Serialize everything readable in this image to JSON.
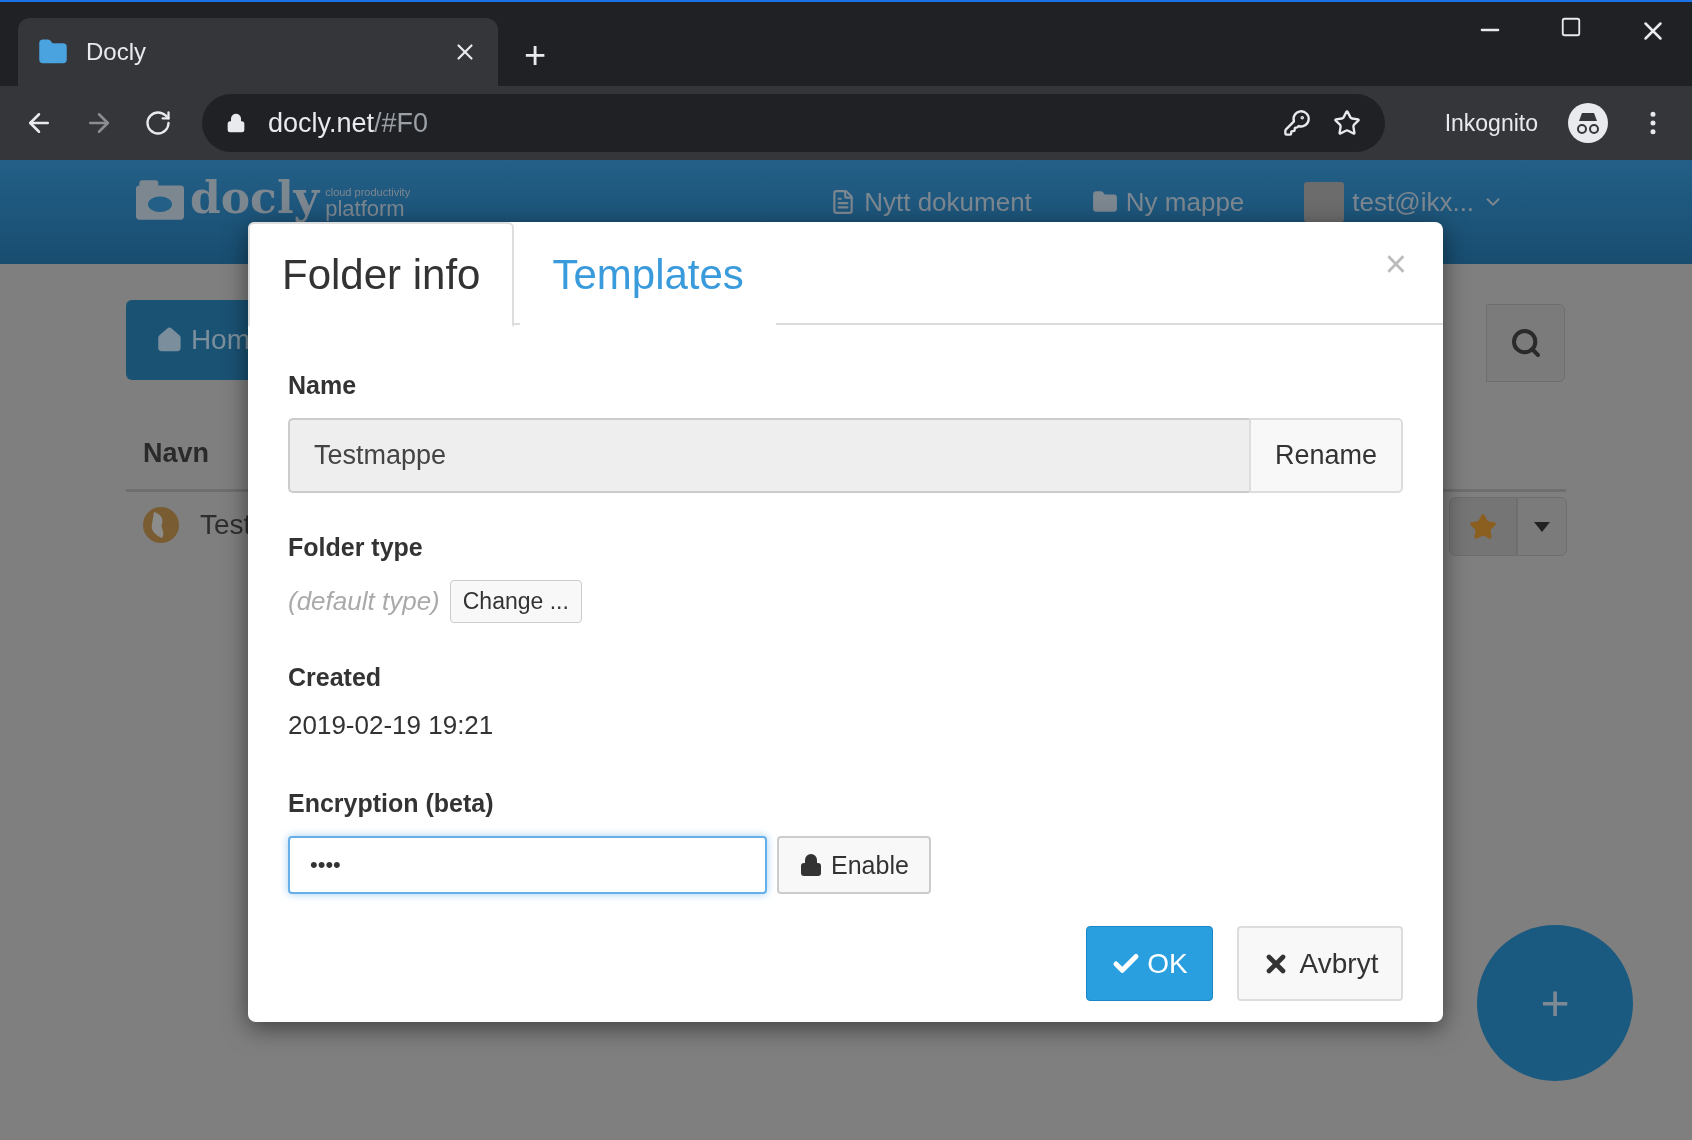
{
  "browser": {
    "tab_title": "Docly",
    "new_tab": "+",
    "url_host": "docly.net",
    "url_path": "/#F0",
    "profile": "Inkognito"
  },
  "header": {
    "logo": "docly",
    "tagline_1": "cloud productivity",
    "tagline_2": "platform",
    "nav": [
      "Nytt dokument",
      "Ny mappe"
    ],
    "user": "test@ikx..."
  },
  "page": {
    "home_button": "Hom",
    "column": "Navn",
    "row": "Test"
  },
  "dialog": {
    "tabs": [
      {
        "label": "Folder info",
        "selected": true
      },
      {
        "label": "Templates",
        "selected": false
      }
    ],
    "close": "×",
    "name_label": "Name",
    "name_value": "Testmappe",
    "rename": "Rename",
    "type_label": "Folder type",
    "type_value": "(default type)",
    "change": "Change ...",
    "created_label": "Created",
    "created_value": "2019-02-19 19:21",
    "encryption_label": "Encryption (beta)",
    "encryption_value": "••••",
    "encryption_focused": true,
    "enable": "Enable",
    "ok": "OK",
    "cancel": "Avbryt"
  },
  "fab": "+"
}
